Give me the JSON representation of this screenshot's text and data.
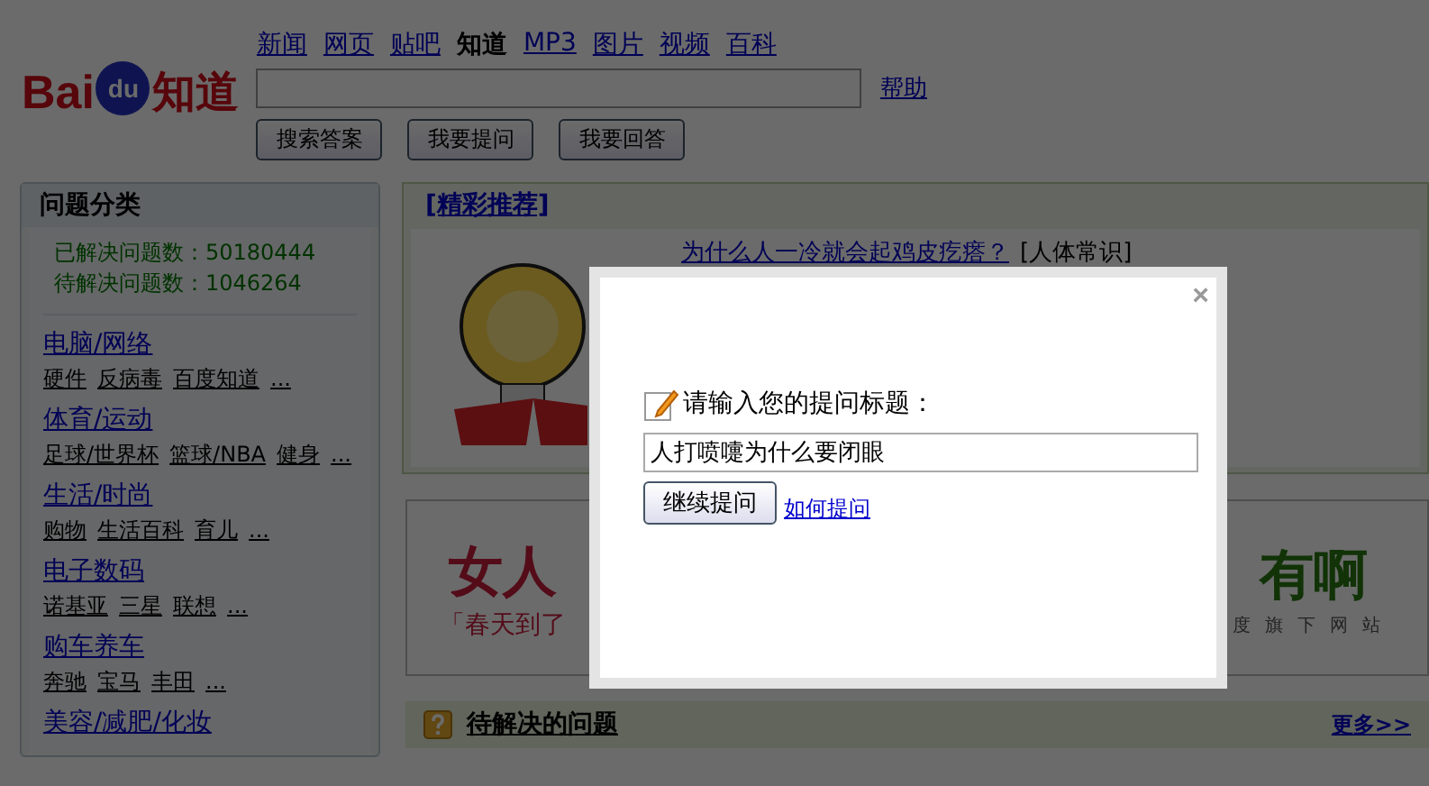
{
  "logo": {
    "latin": "Bai",
    "badge": "du",
    "name": "知道"
  },
  "nav": [
    {
      "label": "新闻",
      "selected": false
    },
    {
      "label": "网页",
      "selected": false
    },
    {
      "label": "贴吧",
      "selected": false
    },
    {
      "label": "知道",
      "selected": true
    },
    {
      "label": "MP3",
      "selected": false
    },
    {
      "label": "图片",
      "selected": false
    },
    {
      "label": "视频",
      "selected": false
    },
    {
      "label": "百科",
      "selected": false
    }
  ],
  "help_link": "帮助",
  "search_buttons": [
    "搜索答案",
    "我要提问",
    "我要回答"
  ],
  "sidebar": {
    "title": "问题分类",
    "stats": [
      {
        "label": "已解决问题数：",
        "value": "50180444"
      },
      {
        "label": "待解决问题数：",
        "value": "1046264"
      }
    ],
    "categories": [
      {
        "title": "电脑/网络",
        "subs": [
          "硬件",
          "反病毒",
          "百度知道",
          "..."
        ]
      },
      {
        "title": "体育/运动",
        "subs": [
          "足球/世界杯",
          "篮球/NBA",
          "健身",
          "..."
        ]
      },
      {
        "title": "生活/时尚",
        "subs": [
          "购物",
          "生活百科",
          "育儿",
          "..."
        ]
      },
      {
        "title": "电子数码",
        "subs": [
          "诺基亚",
          "三星",
          "联想",
          "..."
        ]
      },
      {
        "title": "购车养车",
        "subs": [
          "奔驰",
          "宝马",
          "丰田",
          "..."
        ]
      },
      {
        "title": "美容/减肥/化妆"
      }
    ]
  },
  "featured": {
    "title": "[精彩推荐]",
    "question": "为什么人一冷就会起鸡皮疙瘩？",
    "tag": "[人体常识]"
  },
  "banner": {
    "left_title": "女人",
    "left_sub": "「春天到了",
    "right_title": "有啊",
    "right_sub": "度旗下网站"
  },
  "pending": {
    "title": "待解决的问题",
    "more": "更多>>"
  },
  "dialog": {
    "prompt": "请输入您的提问标题：",
    "value": "人打喷嚏为什么要闭眼",
    "submit": "继续提问",
    "help_link": "如何提问",
    "close": "×"
  }
}
